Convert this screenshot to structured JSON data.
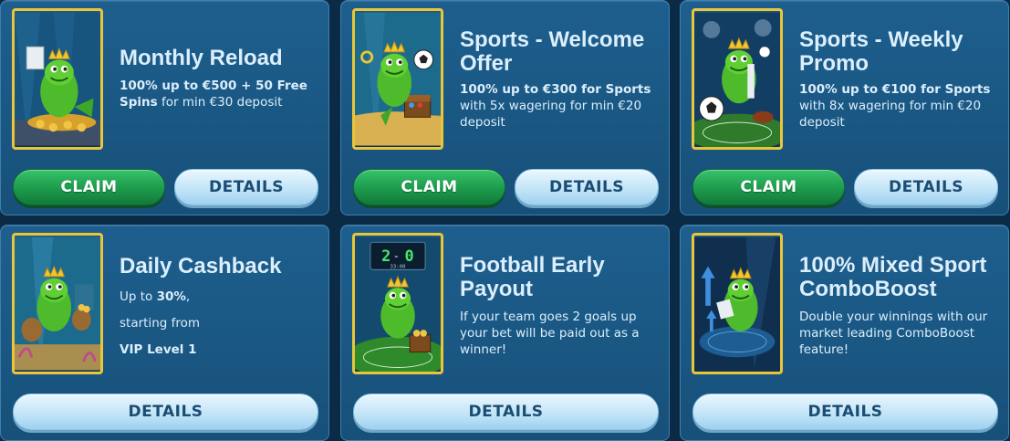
{
  "cards": [
    {
      "title": "Monthly Reload",
      "desc_bold": "100% up to €500 + 50 Free Spins",
      "desc_rest": " for min €30 deposit",
      "claim_label": "CLAIM",
      "details_label": "DETAILS"
    },
    {
      "title": "Sports - Welcome Offer",
      "desc_bold": "100% up to €300 for Sports",
      "desc_rest": " with 5x wagering for min €20 deposit",
      "claim_label": "CLAIM",
      "details_label": "DETAILS"
    },
    {
      "title": "Sports - Weekly Promo",
      "desc_bold": "100% up to €100 for Sports",
      "desc_rest": " with 8x wagering for min €20 deposit",
      "claim_label": "CLAIM",
      "details_label": "DETAILS"
    },
    {
      "title": "Daily Cashback",
      "line1_pre": "Up to ",
      "line1_bold": "30%",
      "line1_post": ",",
      "line2": "starting from",
      "line3": "VIP Level 1",
      "details_label": "DETAILS"
    },
    {
      "title": "Football Early Payout",
      "desc": "If your team goes 2 goals up your bet will be paid out as a winner!",
      "scoreboard": {
        "home": "2",
        "sep": "-",
        "away": "0",
        "time": "33:00"
      },
      "details_label": "DETAILS"
    },
    {
      "title": "100% Mixed Sport ComboBoost",
      "desc": "Double your winnings with our market leading ComboBoost feature!",
      "details_label": "DETAILS"
    }
  ],
  "colors": {
    "card_bg": "#1a5783",
    "frame_gold": "#e9c53a",
    "claim_green": "#1c9a4c",
    "details_blue": "#bfe3f7",
    "text_light": "#dbeefb"
  },
  "icons": [
    "fish-mascot-icon",
    "crown-icon",
    "soccer-ball-icon",
    "treasure-chest-icon",
    "coin-bag-icon",
    "scoreboard-icon",
    "up-arrow-icon"
  ]
}
